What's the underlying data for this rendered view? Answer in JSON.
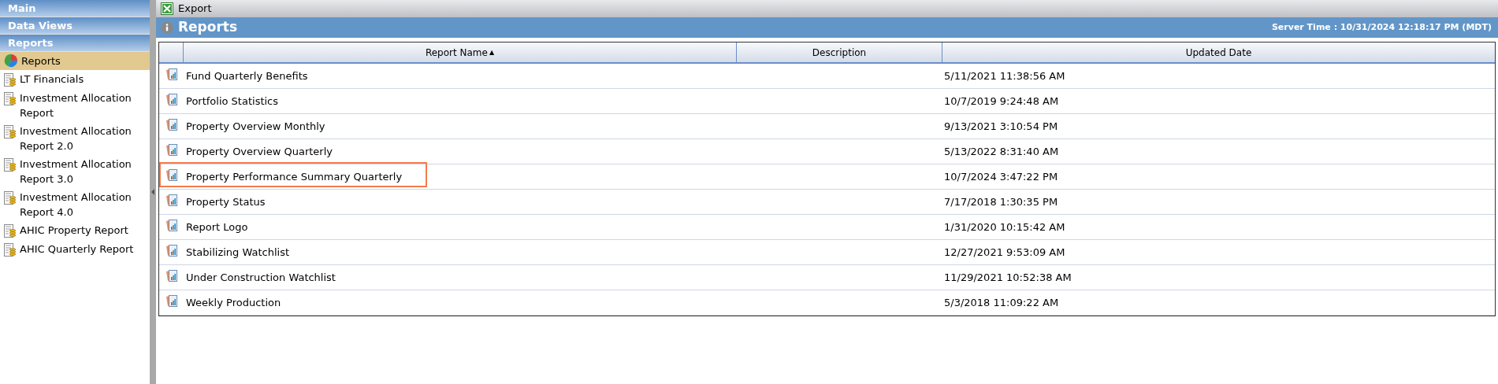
{
  "sidebar": {
    "sections": [
      {
        "title": "Main"
      },
      {
        "title": "Data Views"
      },
      {
        "title": "Reports"
      }
    ],
    "items": [
      {
        "label": "Reports",
        "kind": "chart",
        "selected": true
      },
      {
        "label": "LT Financials",
        "kind": "report",
        "selected": false
      },
      {
        "label": "Investment Allocation Report",
        "kind": "report",
        "selected": false
      },
      {
        "label": "Investment Allocation Report 2.0",
        "kind": "report",
        "selected": false
      },
      {
        "label": "Investment Allocation Report 3.0",
        "kind": "report",
        "selected": false
      },
      {
        "label": "Investment Allocation Report 4.0",
        "kind": "report",
        "selected": false
      },
      {
        "label": "AHIC Property Report",
        "kind": "report",
        "selected": false
      },
      {
        "label": "AHIC Quarterly Report",
        "kind": "report",
        "selected": false
      }
    ]
  },
  "toolbar": {
    "export_label": "Export"
  },
  "header": {
    "title": "Reports",
    "server_time": "Server Time : 10/31/2024 12:18:17 PM (MDT)"
  },
  "table": {
    "columns": [
      {
        "label": "Report Name",
        "sort": "▲"
      },
      {
        "label": "Description"
      },
      {
        "label": "Updated Date"
      }
    ],
    "rows": [
      {
        "name": "Fund Quarterly Benefits",
        "updated": "5/11/2021 11:38:56 AM",
        "highlighted": false
      },
      {
        "name": "Portfolio Statistics",
        "updated": "10/7/2019 9:24:48 AM",
        "highlighted": false
      },
      {
        "name": "Property Overview Monthly",
        "updated": "9/13/2021 3:10:54 PM",
        "highlighted": false
      },
      {
        "name": "Property Overview Quarterly",
        "updated": "5/13/2022 8:31:40 AM",
        "highlighted": false
      },
      {
        "name": "Property Performance Summary Quarterly",
        "updated": "10/7/2024 3:47:22 PM",
        "highlighted": true
      },
      {
        "name": "Property Status",
        "updated": "7/17/2018 1:30:35 PM",
        "highlighted": false
      },
      {
        "name": "Report Logo",
        "updated": "1/31/2020 10:15:42 AM",
        "highlighted": false
      },
      {
        "name": "Stabilizing Watchlist",
        "updated": "12/27/2021 9:53:09 AM",
        "highlighted": false
      },
      {
        "name": "Under Construction Watchlist",
        "updated": "11/29/2021 10:52:38 AM",
        "highlighted": false
      },
      {
        "name": "Weekly Production",
        "updated": "5/3/2018 11:09:22 AM",
        "highlighted": false
      }
    ]
  }
}
